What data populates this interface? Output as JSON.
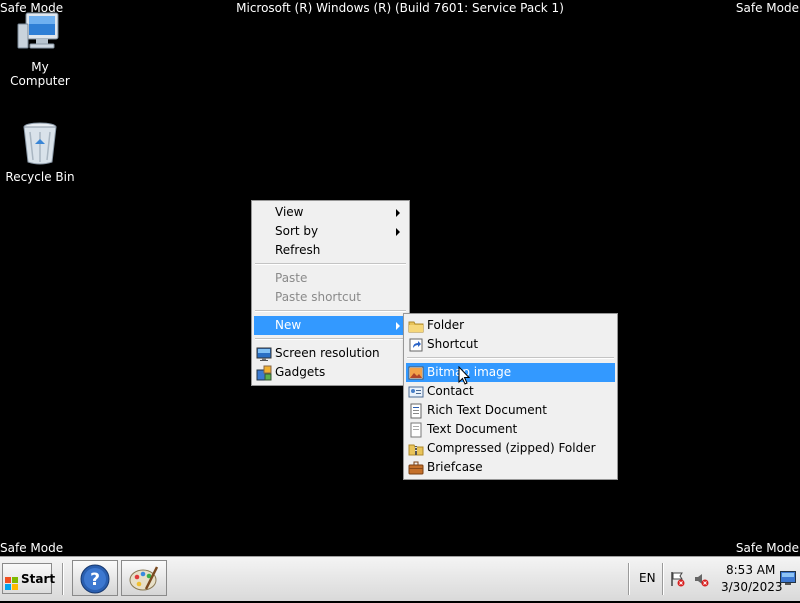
{
  "screen": {
    "title": "Microsoft (R) Windows (R) (Build 7601: Service Pack 1)",
    "corner_label": "Safe Mode"
  },
  "desktop_icons": [
    {
      "label": "My Computer",
      "icon": "computer-icon"
    },
    {
      "label": "Recycle Bin",
      "icon": "recycle-bin-icon"
    }
  ],
  "context_menu": {
    "items": [
      {
        "label": "View",
        "submenu": true
      },
      {
        "label": "Sort by",
        "submenu": true
      },
      {
        "label": "Refresh"
      },
      {
        "label": "Paste",
        "disabled": true
      },
      {
        "label": "Paste shortcut",
        "disabled": true
      },
      {
        "label": "New",
        "submenu": true,
        "highlighted": true
      },
      {
        "label": "Screen resolution",
        "icon": "screen-resolution-icon"
      },
      {
        "label": "Gadgets",
        "icon": "gadgets-icon"
      }
    ]
  },
  "new_submenu": {
    "items": [
      {
        "label": "Folder",
        "icon": "folder-icon"
      },
      {
        "label": "Shortcut",
        "icon": "shortcut-icon"
      },
      {
        "label": "Bitmap image",
        "icon": "bitmap-icon",
        "highlighted": true
      },
      {
        "label": "Contact",
        "icon": "contact-icon"
      },
      {
        "label": "Rich Text Document",
        "icon": "rtf-document-icon"
      },
      {
        "label": "Text Document",
        "icon": "text-document-icon"
      },
      {
        "label": "Compressed (zipped) Folder",
        "icon": "zip-folder-icon"
      },
      {
        "label": "Briefcase",
        "icon": "briefcase-icon"
      }
    ]
  },
  "taskbar": {
    "start_label": "Start",
    "pinned": [
      {
        "name": "help-and-support",
        "icon": "help-icon"
      },
      {
        "name": "paint",
        "icon": "paint-palette-icon"
      }
    ],
    "language": "EN",
    "time": "8:53 AM",
    "date": "3/30/2023"
  },
  "colors": {
    "desktop_bg": "#000000",
    "menu_bg": "#f0f0f0",
    "highlight": "#3399ff"
  }
}
